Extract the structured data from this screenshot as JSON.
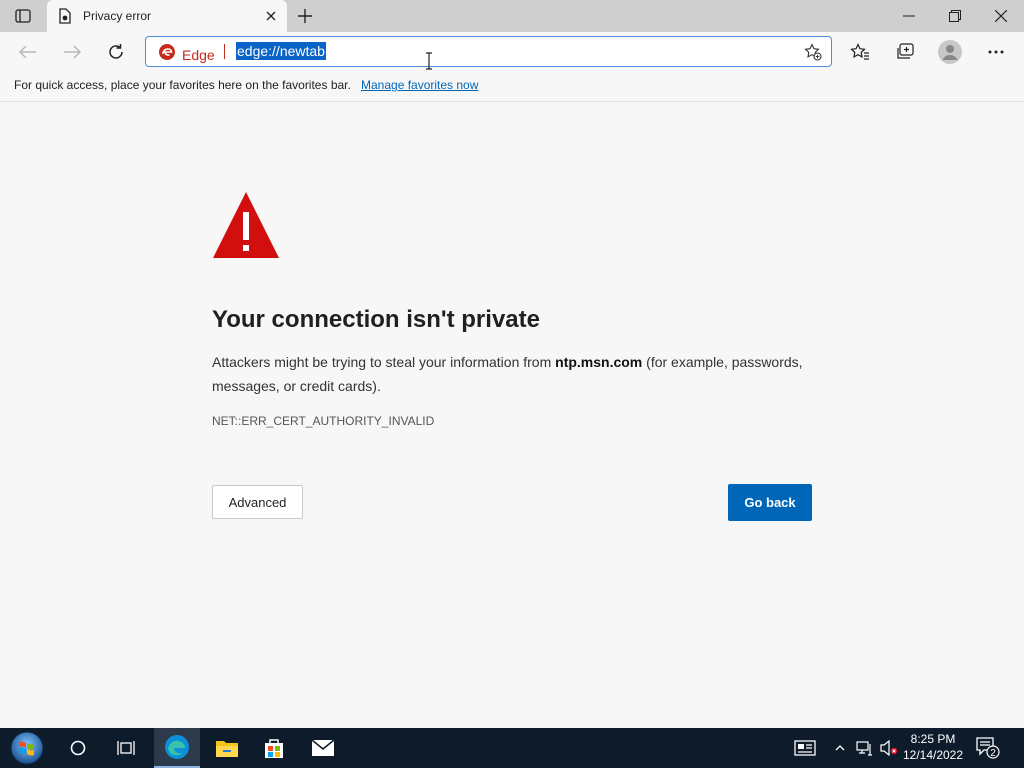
{
  "browser": {
    "tab": {
      "title": "Privacy error"
    },
    "omnibox": {
      "site_label": "Edge",
      "url": "edge://newtab"
    }
  },
  "favorites_bar": {
    "text": "For quick access, place your favorites here on the favorites bar.",
    "link": "Manage favorites now"
  },
  "page": {
    "headline": "Your connection isn't private",
    "desc_prefix": "Attackers might be trying to steal your information from ",
    "domain": "ntp.msn.com",
    "desc_suffix": " (for example, passwords, messages, or credit cards).",
    "error_code": "NET::ERR_CERT_AUTHORITY_INVALID",
    "advanced_label": "Advanced",
    "go_back_label": "Go back"
  },
  "taskbar": {
    "time": "8:25 PM",
    "date": "12/14/2022",
    "notification_count": "2"
  },
  "colors": {
    "accent": "#0067b8",
    "warning": "#d20f0f",
    "edge_red": "#c42b1c",
    "taskbar_bg": "#0d1b2b"
  }
}
